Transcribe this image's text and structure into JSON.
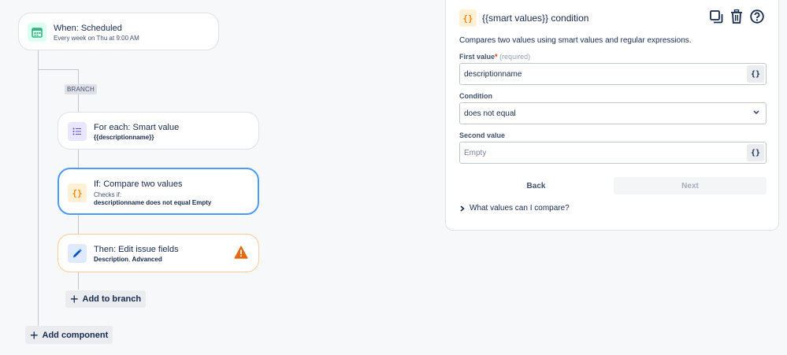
{
  "trigger": {
    "title": "When: Scheduled",
    "subtitle": "Every week on Thu at 9:00 AM",
    "icon": "calendar-icon",
    "icon_color": "#36b37e"
  },
  "branch": {
    "badge": "BRANCH",
    "for_each": {
      "title": "For each: Smart value",
      "subtitle": "{{descriptionname}}",
      "icon": "list-icon"
    },
    "if_card": {
      "title": "If: Compare two values",
      "checks_label": "Checks if:",
      "detail": "descriptionname does not equal Empty",
      "icon": "braces-icon",
      "selected_border": "#4c9aff"
    },
    "then_card": {
      "title": "Then: Edit issue fields",
      "detail_a": "Description",
      "detail_sep": ", ",
      "detail_b": "Advanced",
      "icon": "pencil-icon",
      "warning_icon": "warning-icon",
      "warning_color": "#e56910"
    },
    "add_to_branch": "Add to branch"
  },
  "add_component": "Add component",
  "panel": {
    "title": "{{smart values}} condition",
    "description": "Compares two values using smart values and regular expressions.",
    "tools": [
      "duplicate-icon",
      "trash-icon",
      "help-icon"
    ],
    "first_value": {
      "label": "First value",
      "required_mark": "*",
      "hint": "(required)",
      "value": "descriptionname"
    },
    "condition": {
      "label": "Condition",
      "value": "does not equal"
    },
    "second_value": {
      "label": "Second value",
      "placeholder": "Empty"
    },
    "smart_button": "{}",
    "back": "Back",
    "next": "Next",
    "expander": "What values can I compare?"
  }
}
